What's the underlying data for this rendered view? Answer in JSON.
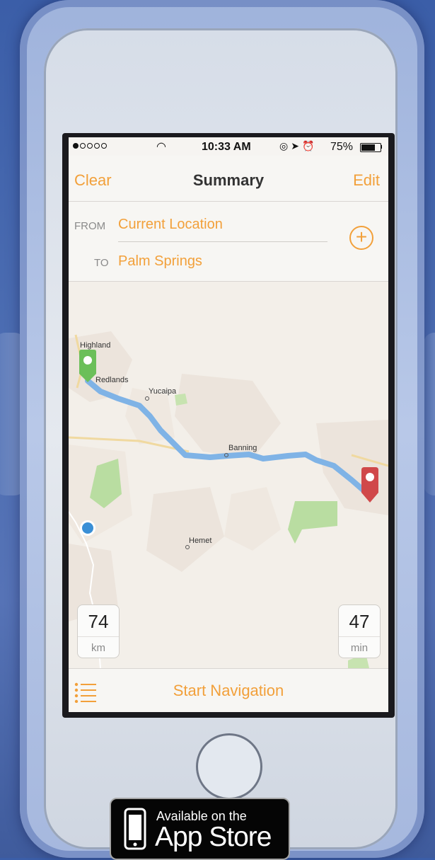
{
  "status_bar": {
    "time": "10:33 AM",
    "battery": "75%",
    "battery_level": 0.75,
    "signal_dots_on": 1,
    "signal_dots_total": 5
  },
  "nav": {
    "left": "Clear",
    "title": "Summary",
    "right": "Edit"
  },
  "route": {
    "from_label": "FROM",
    "from_value": "Current Location",
    "to_label": "TO",
    "to_value": "Palm Springs",
    "add_icon": "plus-circle-icon"
  },
  "map": {
    "labels": [
      "Highland",
      "Redlands",
      "Yucaipa",
      "Banning",
      "Hemet"
    ],
    "route_color": "#7fb3e6",
    "start_pin_color": "#6bbf59",
    "end_pin_color": "#d0484a",
    "location_dot_color": "#3a8fd6"
  },
  "stats": {
    "distance": {
      "value": "74",
      "unit": "km"
    },
    "duration": {
      "value": "47",
      "unit": "min"
    }
  },
  "bottom": {
    "list_icon": "list-icon",
    "start_label": "Start Navigation"
  },
  "badge": {
    "small": "Available on the",
    "big": "App Store",
    "icon": "apple-phone-icon"
  },
  "colors": {
    "accent": "#f2a03a",
    "background": "#4c6db2"
  }
}
